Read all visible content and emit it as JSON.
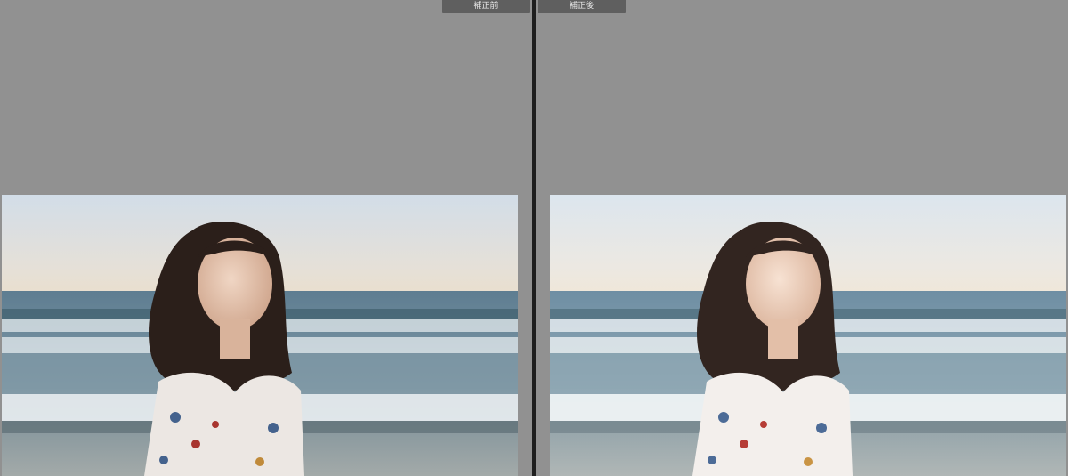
{
  "compare_view": {
    "before": {
      "label": "補正前"
    },
    "after": {
      "label": "補正後"
    }
  },
  "colors": {
    "background": "#919191",
    "divider": "#1e1e1e",
    "label_bg": "#5f5f5f",
    "label_text": "#ececec"
  },
  "icons": {
    "photo": "portrait-photo"
  }
}
